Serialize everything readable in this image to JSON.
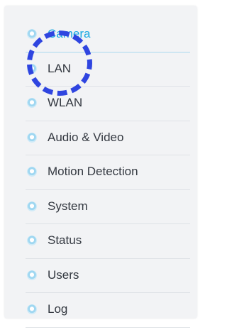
{
  "menu": {
    "items": [
      {
        "label": "Camera",
        "active": true
      },
      {
        "label": "LAN",
        "active": false
      },
      {
        "label": "WLAN",
        "active": false
      },
      {
        "label": "Audio & Video",
        "active": false
      },
      {
        "label": "Motion Detection",
        "active": false
      },
      {
        "label": "System",
        "active": false
      },
      {
        "label": "Status",
        "active": false
      },
      {
        "label": "Users",
        "active": false
      },
      {
        "label": "Log",
        "active": false
      }
    ]
  },
  "colors": {
    "accent": "#1aa8e2",
    "text": "#333840",
    "panel_bg": "#f2f3f5",
    "focus_ring": "#2f45e0"
  },
  "icons": {
    "bullet": "circle-bullet-icon"
  }
}
